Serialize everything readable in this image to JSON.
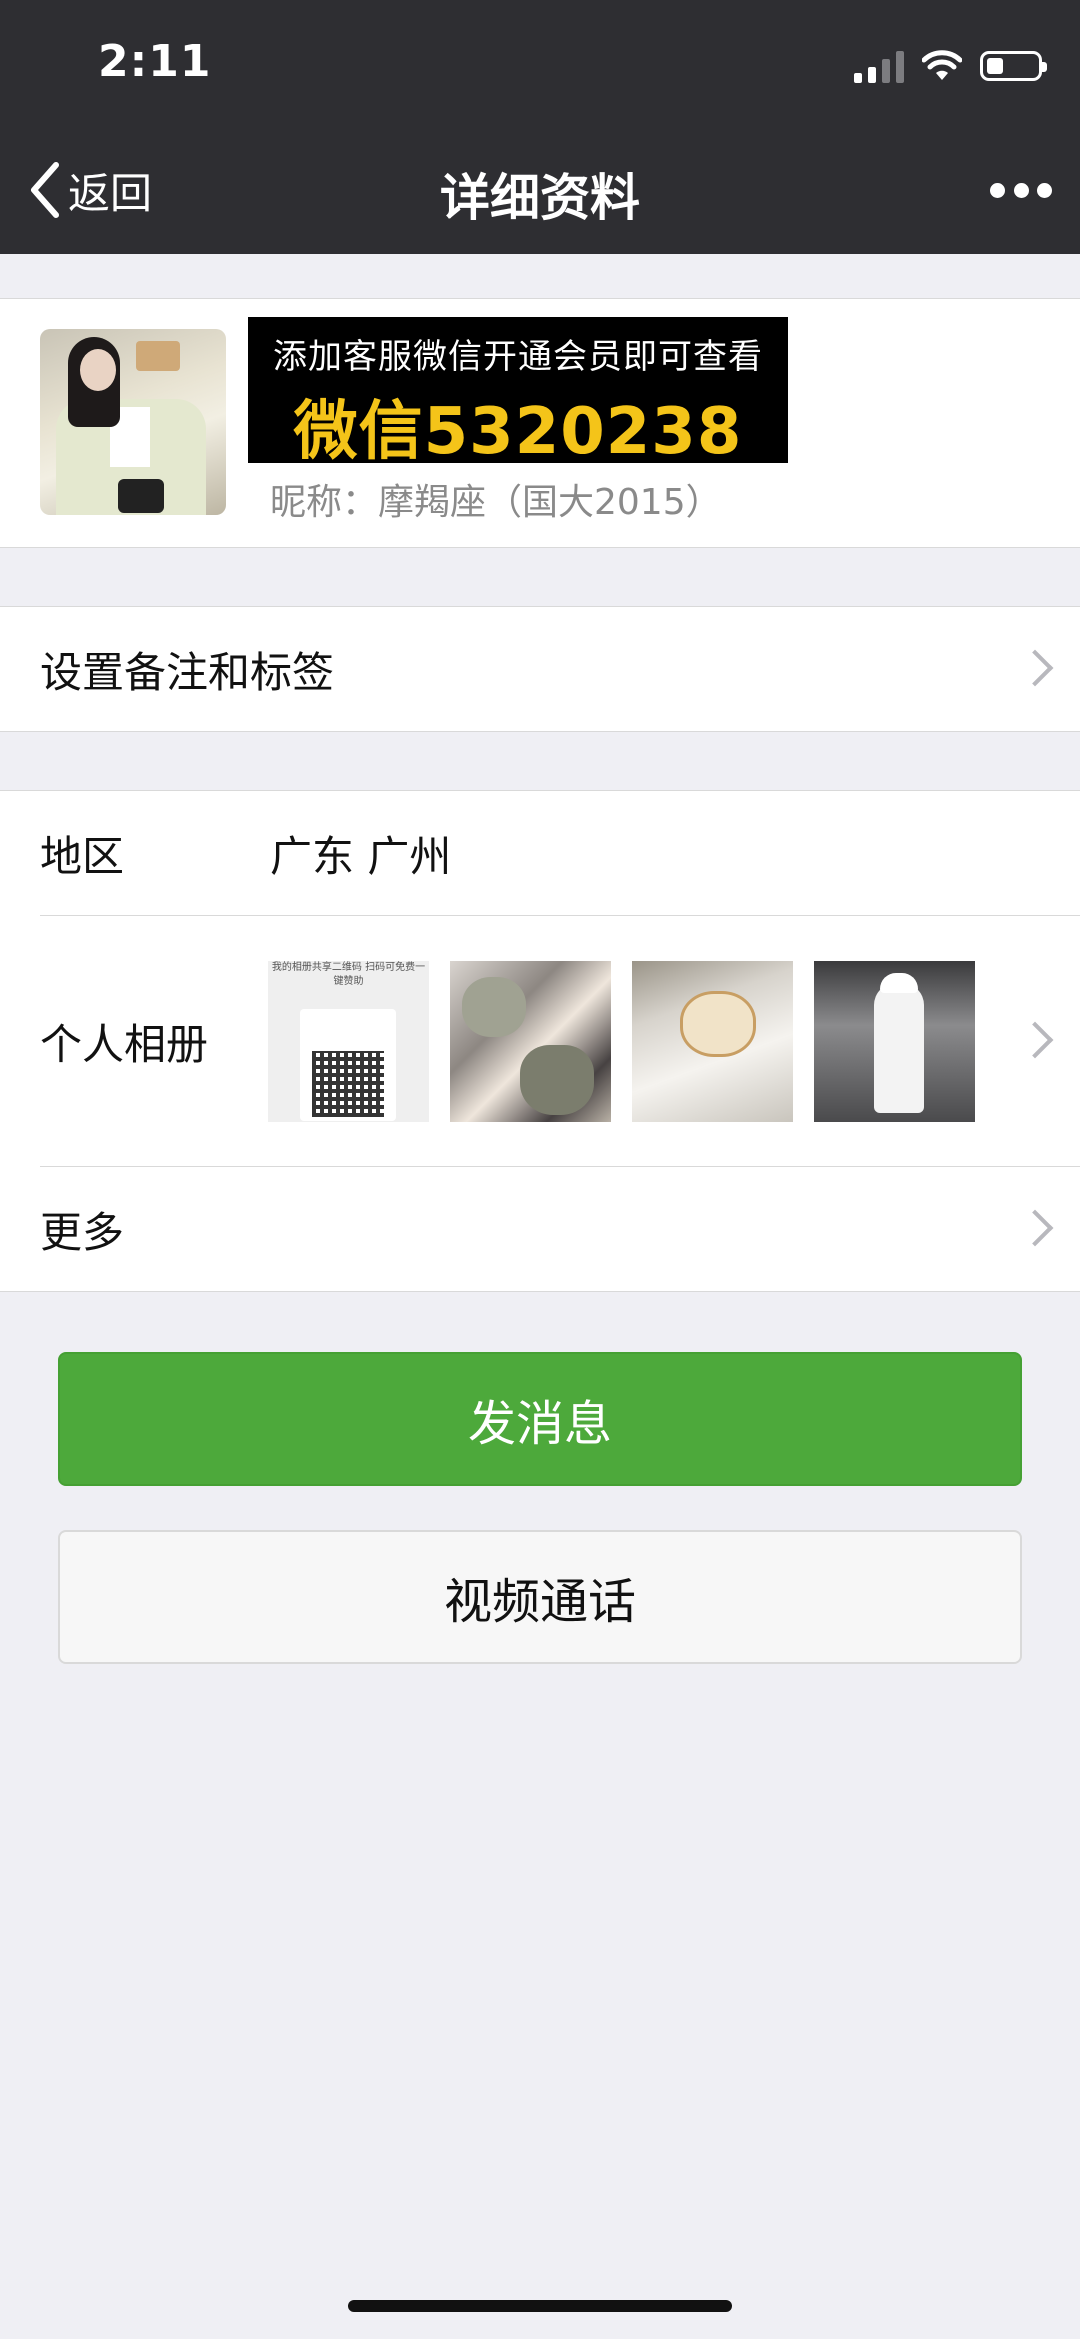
{
  "status_bar": {
    "time": "2:11"
  },
  "nav": {
    "back_label": "返回",
    "title": "详细资料"
  },
  "profile": {
    "ad_line1": "添加客服微信开通会员即可查看",
    "ad_line2": "微信5320238",
    "nickname": "昵称：摩羯座（国大2015）"
  },
  "rows": {
    "remarks_label": "设置备注和标签",
    "region_label": "地区",
    "region_value": "广东 广州",
    "album_label": "个人相册",
    "album_thumb1_caption": "我的相册共享二维码 扫码可免费一键赞助",
    "more_label": "更多"
  },
  "buttons": {
    "send_message": "发消息",
    "video_call": "视频通话"
  },
  "colors": {
    "nav_bg": "#2e2e32",
    "primary_green": "#4da93b",
    "ad_yellow": "#f4c419",
    "page_bg": "#efeff4"
  },
  "icons": [
    "signal-icon",
    "wifi-icon",
    "battery-icon",
    "back-chevron-icon",
    "more-dots-icon",
    "chevron-right-icon"
  ]
}
